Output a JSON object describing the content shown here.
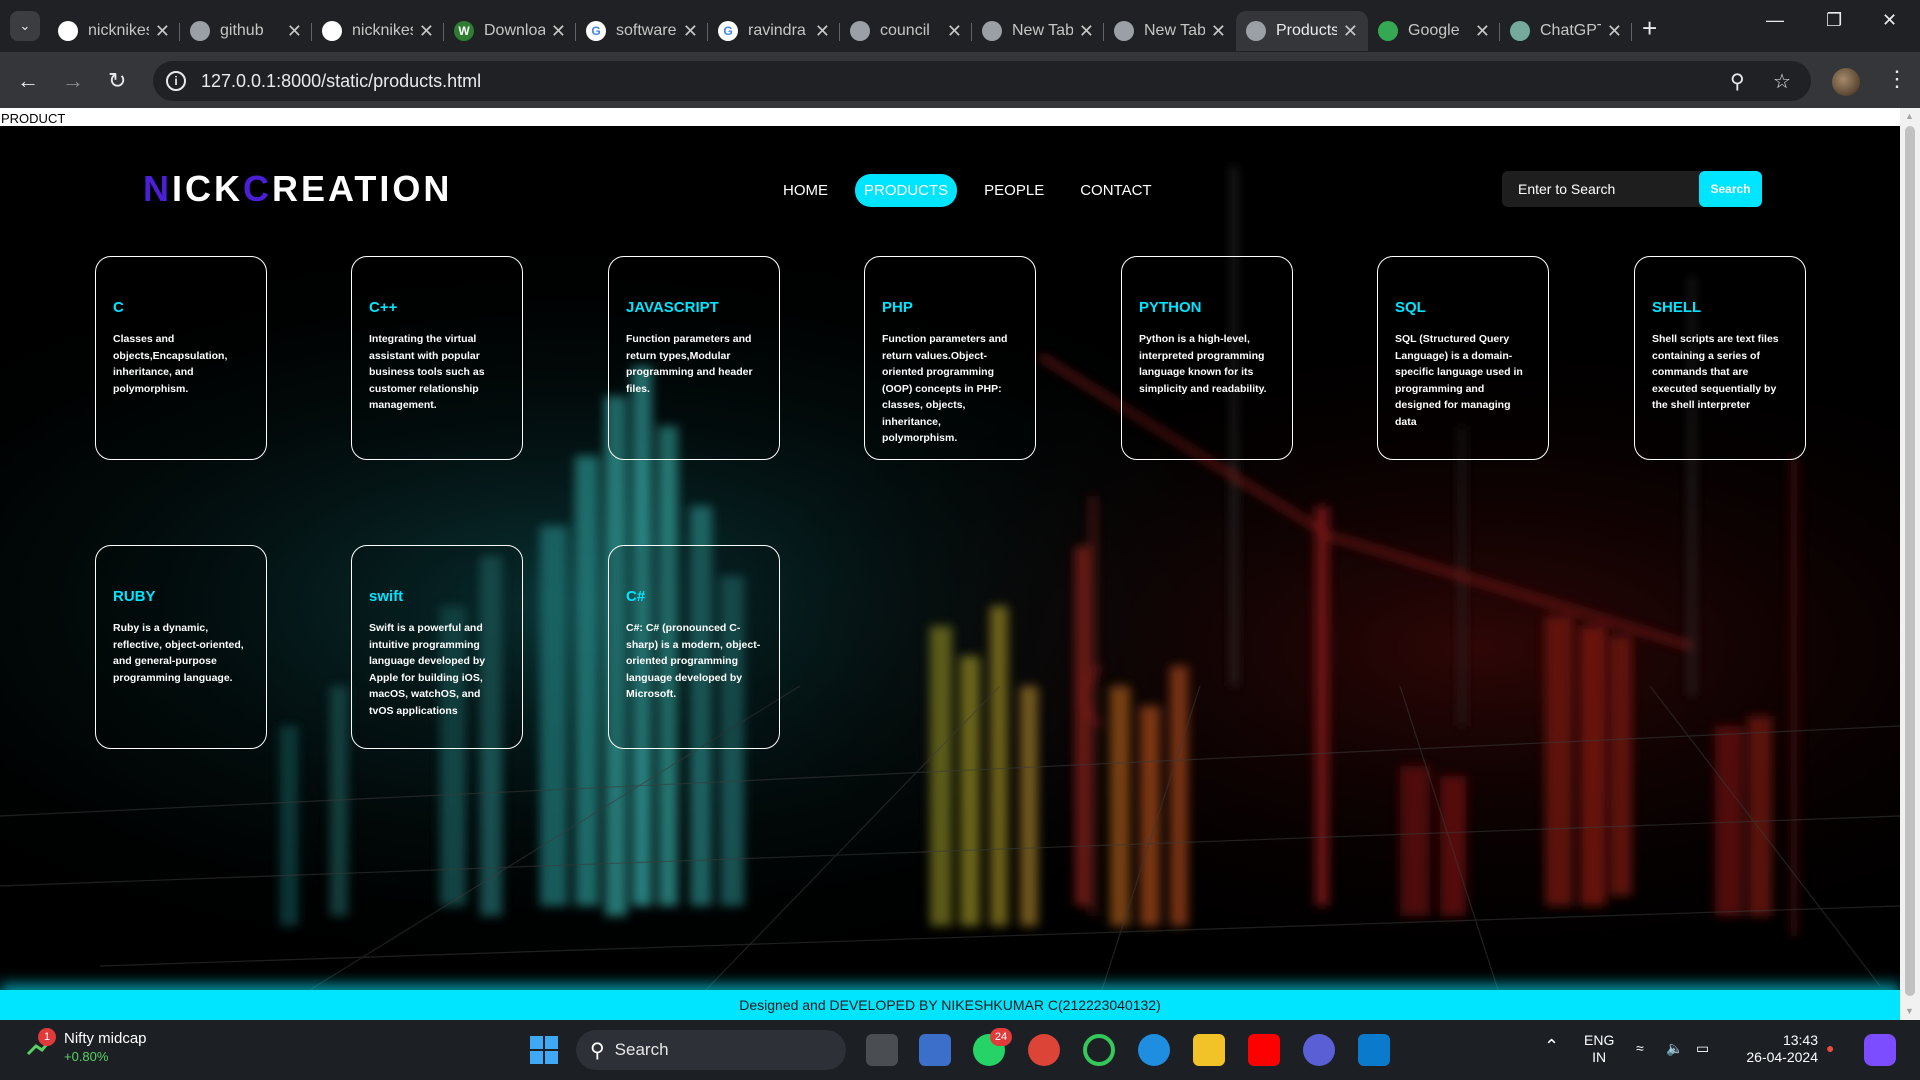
{
  "browser": {
    "tabs": [
      {
        "title": "nicknikes",
        "icon": "github-icon"
      },
      {
        "title": "github",
        "icon": "globe-icon"
      },
      {
        "title": "nicknikes",
        "icon": "github-icon"
      },
      {
        "title": "Download",
        "icon": "w-logo-icon"
      },
      {
        "title": "software",
        "icon": "google-icon"
      },
      {
        "title": "ravindra",
        "icon": "google-icon"
      },
      {
        "title": "council",
        "icon": "globe-icon"
      },
      {
        "title": "New Tab",
        "icon": "chrome-icon"
      },
      {
        "title": "New Tab",
        "icon": "chrome-icon"
      },
      {
        "title": "Products",
        "icon": "globe-icon",
        "active": true
      },
      {
        "title": "Google",
        "icon": "google-meet-icon"
      },
      {
        "title": "ChatGPT",
        "icon": "chatgpt-icon"
      }
    ],
    "url": "127.0.0.1:8000/static/products.html"
  },
  "page": {
    "crumb": "PRODUCT",
    "logo": {
      "part1": "N",
      "part2": "I",
      "part3": "CK",
      "part4": "C",
      "part5": "REATION"
    },
    "nav": [
      {
        "label": "HOME",
        "active": false
      },
      {
        "label": "PRODUCTS",
        "active": true
      },
      {
        "label": "PEOPLE",
        "active": false
      },
      {
        "label": "CONTACT",
        "active": false
      }
    ],
    "search": {
      "placeholder": "Enter to Search",
      "button": "Search"
    },
    "cards": [
      {
        "title": "C",
        "desc": "Classes and objects,Encapsulation, inheritance, and polymorphism."
      },
      {
        "title": "C++",
        "desc": "Integrating the virtual assistant with popular business tools such as customer relationship management."
      },
      {
        "title": "JAVASCRIPT",
        "desc": "Function parameters and return types,Modular programming and header files."
      },
      {
        "title": "PHP",
        "desc": "Function parameters and return values.Object-oriented programming (OOP) concepts in PHP: classes, objects, inheritance, polymorphism."
      },
      {
        "title": "PYTHON",
        "desc": "Python is a high-level, interpreted programming language known for its simplicity and readability."
      },
      {
        "title": "SQL",
        "desc": "SQL (Structured Query Language) is a domain-specific language used in programming and designed for managing data"
      },
      {
        "title": "SHELL",
        "desc": "Shell scripts are text files containing a series of commands that are executed sequentially by the shell interpreter"
      },
      {
        "title": "RUBY",
        "desc": "Ruby is a dynamic, reflective, object-oriented, and general-purpose programming language."
      },
      {
        "title": "swift",
        "desc": "Swift is a powerful and intuitive programming language developed by Apple for building iOS, macOS, watchOS, and tvOS applications"
      },
      {
        "title": "C#",
        "desc": "C#: C# (pronounced C-sharp) is a modern, object-oriented programming language developed by Microsoft."
      }
    ],
    "footer": "Designed and DEVELOPED BY NIKESHKUMAR C(212223040132)"
  },
  "taskbar": {
    "widget_title": "Nifty midcap",
    "widget_value": "+0.80%",
    "widget_badge": "1",
    "search_label": "Search",
    "whatsapp_badge": "24",
    "lang_line1": "ENG",
    "lang_line2": "IN",
    "time": "13:43",
    "date": "26-04-2024"
  },
  "colors": {
    "accent": "#00e5ff",
    "logo_accent": "#4a1fd6",
    "background": "#000000"
  }
}
